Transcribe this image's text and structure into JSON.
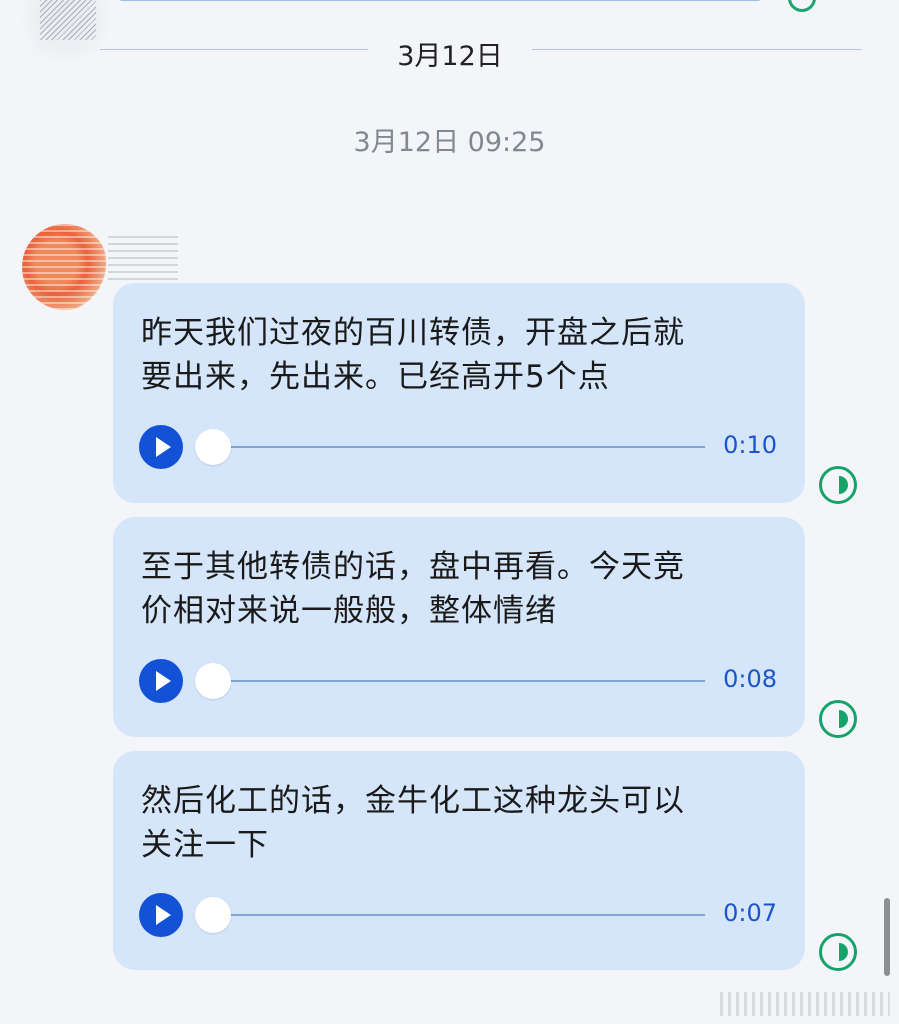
{
  "date_divider": "3月12日",
  "timestamp": "3月12日 09:25",
  "messages": [
    {
      "text_lines": [
        "昨天我们过夜的百川转债，开盘之后就",
        "要出来，先出来。已经高开5个点"
      ],
      "duration": "0:10",
      "progress": 0
    },
    {
      "text_lines": [
        "至于其他转债的话，盘中再看。今天竞",
        "价相对来说一般般，整体情绪"
      ],
      "duration": "0:08",
      "progress": 0
    },
    {
      "text_lines": [
        "然后化工的话，金牛化工这种龙头可以",
        "关注一下"
      ],
      "duration": "0:07",
      "progress": 0
    }
  ],
  "colors": {
    "bubble": "#d6e6fa",
    "play_button": "#1352d6",
    "duration_text": "#1a56c8",
    "status_icon": "#15a36a",
    "background": "#f3f5f8"
  },
  "icons": {
    "play": "play-icon",
    "status": "half-circle-icon"
  }
}
